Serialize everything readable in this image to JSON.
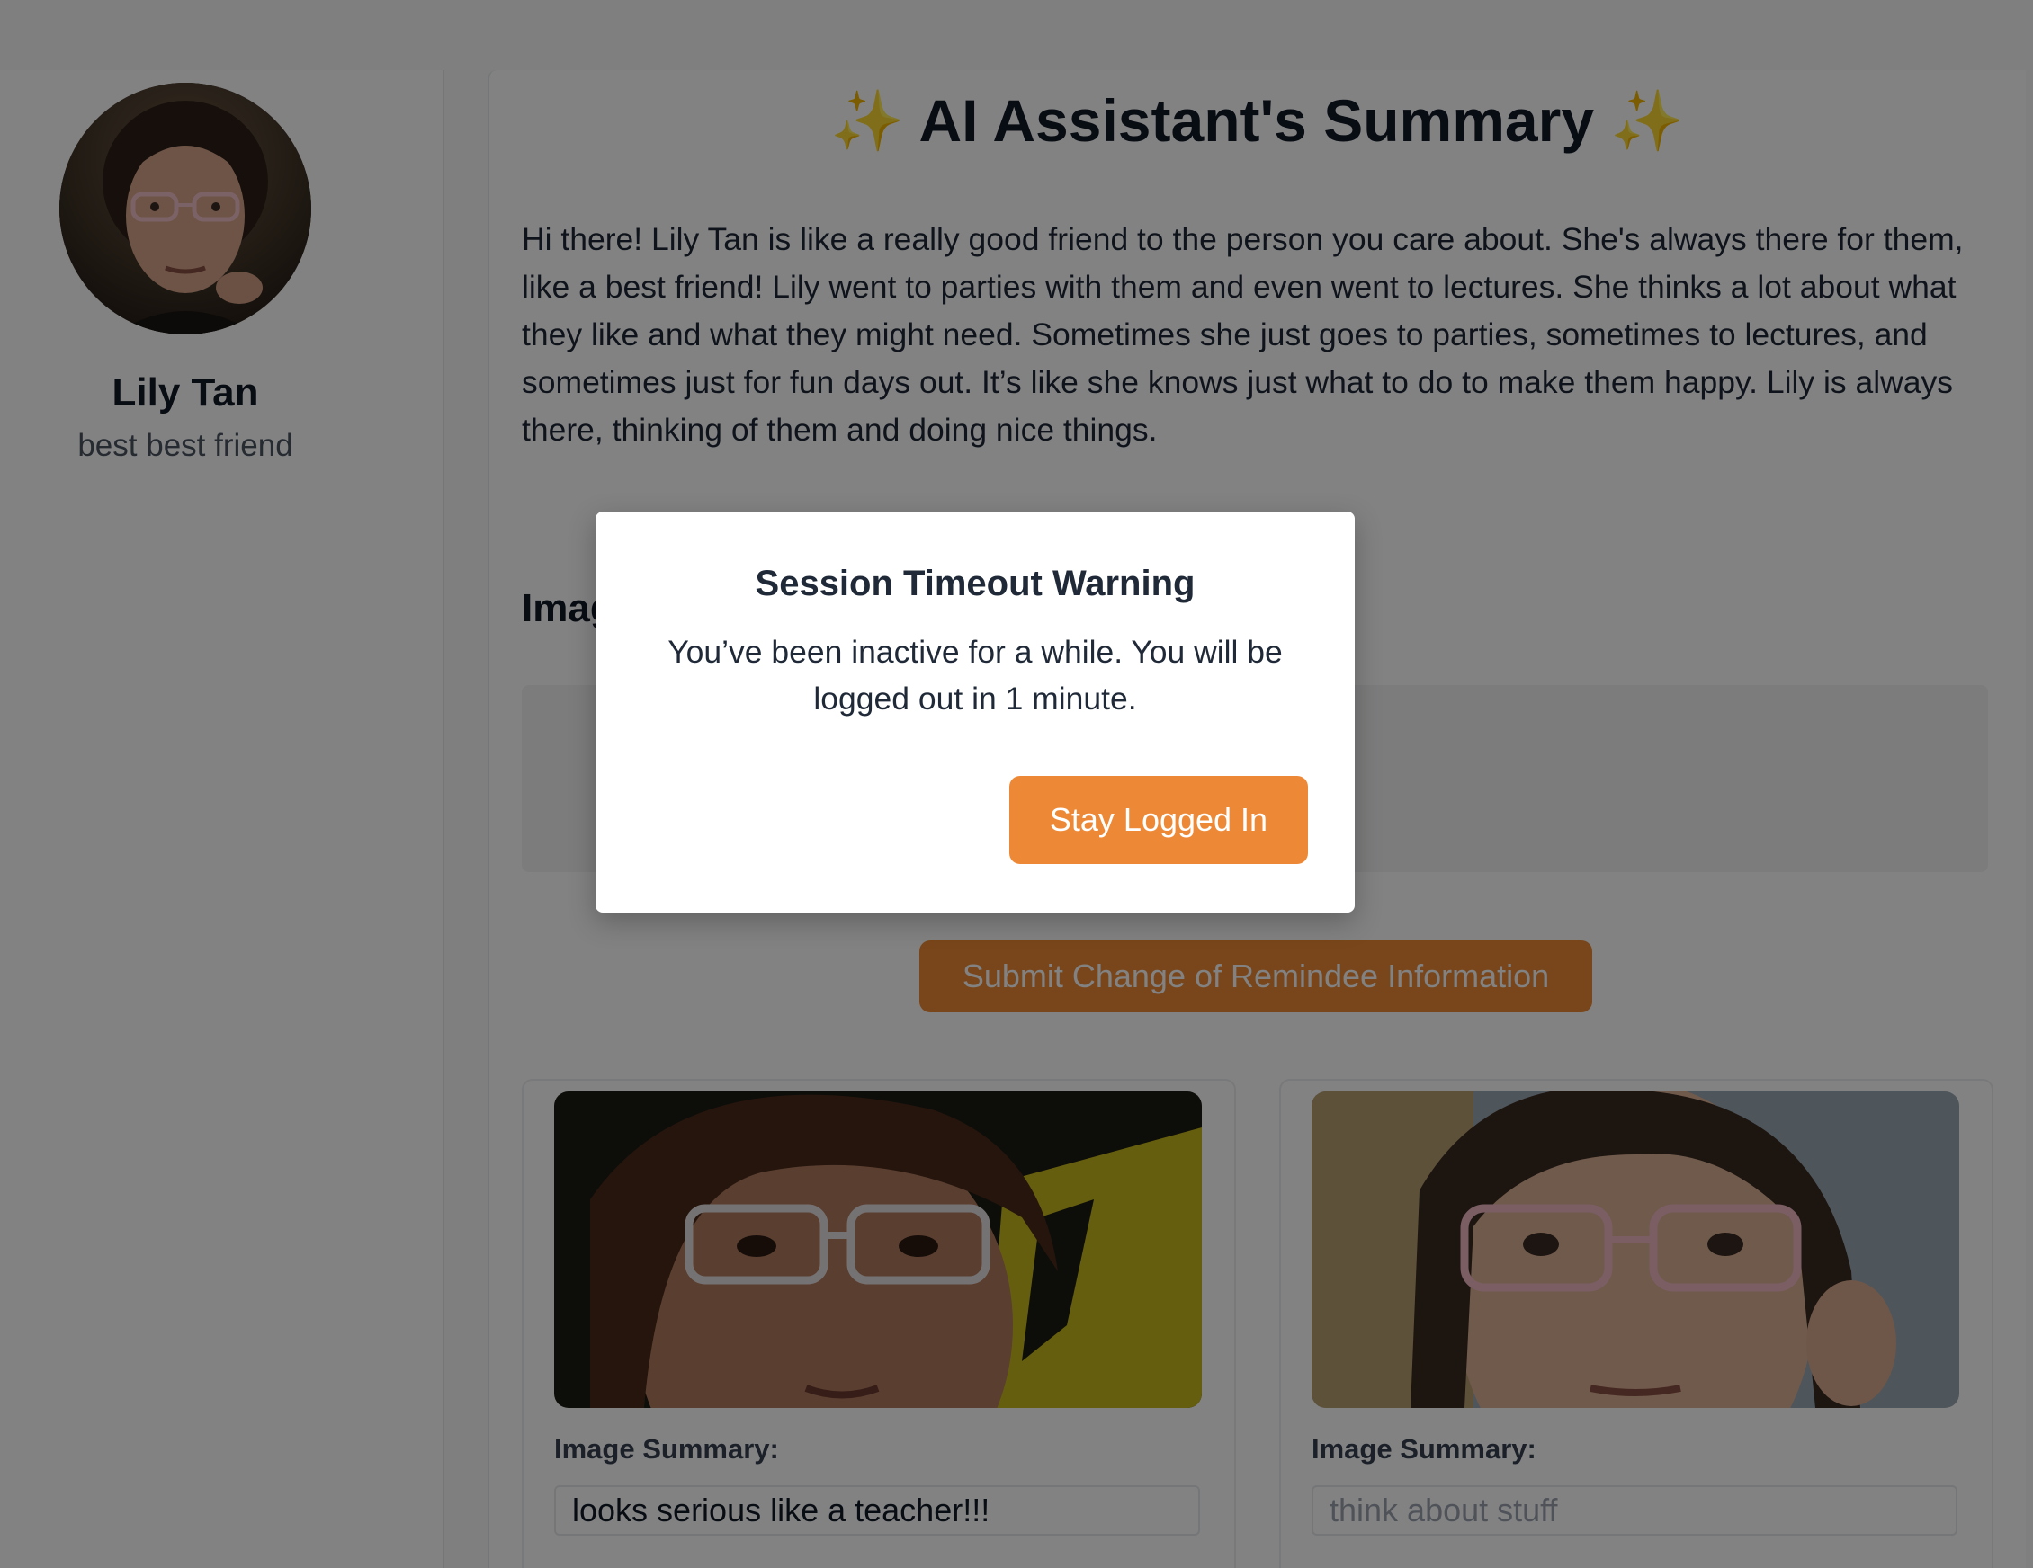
{
  "profile": {
    "name": "Lily Tan",
    "relation": "best best friend",
    "avatar_icon": "person-photo"
  },
  "summary": {
    "sparkle_left": "✨",
    "title": "AI Assistant's Summary",
    "sparkle_right": "✨",
    "text": "Hi there! Lily Tan is like a really good friend to the person you care about. She's always there for them, like a best friend! Lily went to parties with them and even went to lectures. She thinks a lot about what they like and what they might need. Sometimes she just goes to parties, sometimes to lectures, and sometimes just for fun days out. It’s like she knows just what to do to make them happy. Lily is always there, thinking of them and doing nice things."
  },
  "images_section": {
    "heading_partial": "Imag"
  },
  "submit_label": "Submit Change of Remindee Information",
  "cards": [
    {
      "label": "Image Summary:",
      "value": "looks serious like a teacher!!!",
      "placeholder": ""
    },
    {
      "label": "Image Summary:",
      "value": "",
      "placeholder": "think about stuff"
    }
  ],
  "modal": {
    "title": "Session Timeout Warning",
    "message": "You’ve been inactive for a while. You will be logged out in 1 minute.",
    "stay_button": "Stay Logged In"
  },
  "colors": {
    "accent": "#ed8936",
    "overlay": "rgba(0,0,0,0.49)",
    "sparkle": "#facc15"
  }
}
